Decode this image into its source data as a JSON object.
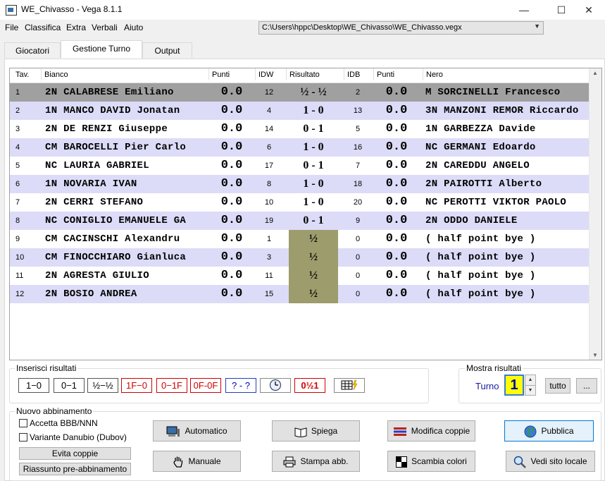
{
  "window": {
    "title": "WE_Chivasso - Vega 8.1.1",
    "minimize": "—",
    "maximize": "☐",
    "close": "✕"
  },
  "menu": [
    "File",
    "Classifica",
    "Extra",
    "Verbali",
    "Aiuto"
  ],
  "file_path": "C:\\Users\\hppc\\Desktop\\WE_Chivasso\\WE_Chivasso.vegx",
  "tabs": [
    "Giocatori",
    "Gestione Turno",
    "Output"
  ],
  "active_tab": "Gestione Turno",
  "table": {
    "headers": {
      "tav": "Tav.",
      "white": "Bianco",
      "wpts": "Punti",
      "idw": "IDW",
      "result": "Risultato",
      "idb": "IDB",
      "bpts": "Punti",
      "black": "Nero"
    },
    "rows": [
      {
        "tav": "1",
        "white": "2N CALABRESE Emiliano",
        "wpts": "0.0",
        "idw": "12",
        "result": "½ - ½",
        "idb": "2",
        "bpts": "0.0",
        "black": "M SORCINELLI Francesco"
      },
      {
        "tav": "2",
        "white": "1N MANCO DAVID Jonatan",
        "wpts": "0.0",
        "idw": "4",
        "result": "1 - 0",
        "idb": "13",
        "bpts": "0.0",
        "black": "3N MANZONI REMOR Riccardo"
      },
      {
        "tav": "3",
        "white": "2N DE RENZI Giuseppe",
        "wpts": "0.0",
        "idw": "14",
        "result": "0 - 1",
        "idb": "5",
        "bpts": "0.0",
        "black": "1N GARBEZZA Davide"
      },
      {
        "tav": "4",
        "white": "CM BAROCELLI Pier Carlo",
        "wpts": "0.0",
        "idw": "6",
        "result": "1 - 0",
        "idb": "16",
        "bpts": "0.0",
        "black": "NC GERMANI Edoardo"
      },
      {
        "tav": "5",
        "white": "NC LAURIA GABRIEL",
        "wpts": "0.0",
        "idw": "17",
        "result": "0 - 1",
        "idb": "7",
        "bpts": "0.0",
        "black": "2N CAREDDU ANGELO"
      },
      {
        "tav": "6",
        "white": "1N NOVARIA IVAN",
        "wpts": "0.0",
        "idw": "8",
        "result": "1 - 0",
        "idb": "18",
        "bpts": "0.0",
        "black": "2N PAIROTTI Alberto"
      },
      {
        "tav": "7",
        "white": "2N CERRI STEFANO",
        "wpts": "0.0",
        "idw": "10",
        "result": "1 - 0",
        "idb": "20",
        "bpts": "0.0",
        "black": "NC PEROTTI VIKTOR PAOLO"
      },
      {
        "tav": "8",
        "white": "NC CONIGLIO EMANUELE GA",
        "wpts": "0.0",
        "idw": "19",
        "result": "0 - 1",
        "idb": "9",
        "bpts": "0.0",
        "black": "2N ODDO DANIELE"
      },
      {
        "tav": "9",
        "white": "CM CACINSCHI Alexandru",
        "wpts": "0.0",
        "idw": "1",
        "result": "½",
        "idb": "0",
        "bpts": "0.0",
        "black": "( half point bye )"
      },
      {
        "tav": "10",
        "white": "CM FINOCCHIARO Gianluca",
        "wpts": "0.0",
        "idw": "3",
        "result": "½",
        "idb": "0",
        "bpts": "0.0",
        "black": "( half point bye )"
      },
      {
        "tav": "11",
        "white": "2N AGRESTA GIULIO",
        "wpts": "0.0",
        "idw": "11",
        "result": "½",
        "idb": "0",
        "bpts": "0.0",
        "black": "( half point bye )"
      },
      {
        "tav": "12",
        "white": "2N BOSIO ANDREA",
        "wpts": "0.0",
        "idw": "15",
        "result": "½",
        "idb": "0",
        "bpts": "0.0",
        "black": "( half point bye )"
      }
    ]
  },
  "inserisci": {
    "label": "Inserisci risultati",
    "buttons": [
      "1−0",
      "0−1",
      "½−½",
      "1F−0",
      "0−1F",
      "0F-0F",
      "? - ?",
      "",
      "0½1",
      ""
    ]
  },
  "mostra": {
    "label": "Mostra risultati",
    "turno_label": "Turno",
    "turno_value": "1",
    "tutto": "tutto",
    "more": "..."
  },
  "abbinamento": {
    "label": "Nuovo abbinamento",
    "chk_bbb": "Accetta BBB/NNN",
    "chk_danubio": "Variante Danubio (Dubov)",
    "evita": "Evita coppie",
    "riassunto": "Riassunto pre-abbinamento",
    "automatico": "Automatico",
    "manuale": "Manuale",
    "spiega": "Spiega",
    "stampa": "Stampa abb.",
    "modifica": "Modifica coppie",
    "scambia": "Scambia colori",
    "pubblica": "Pubblica",
    "vedi": "Vedi sito locale"
  }
}
